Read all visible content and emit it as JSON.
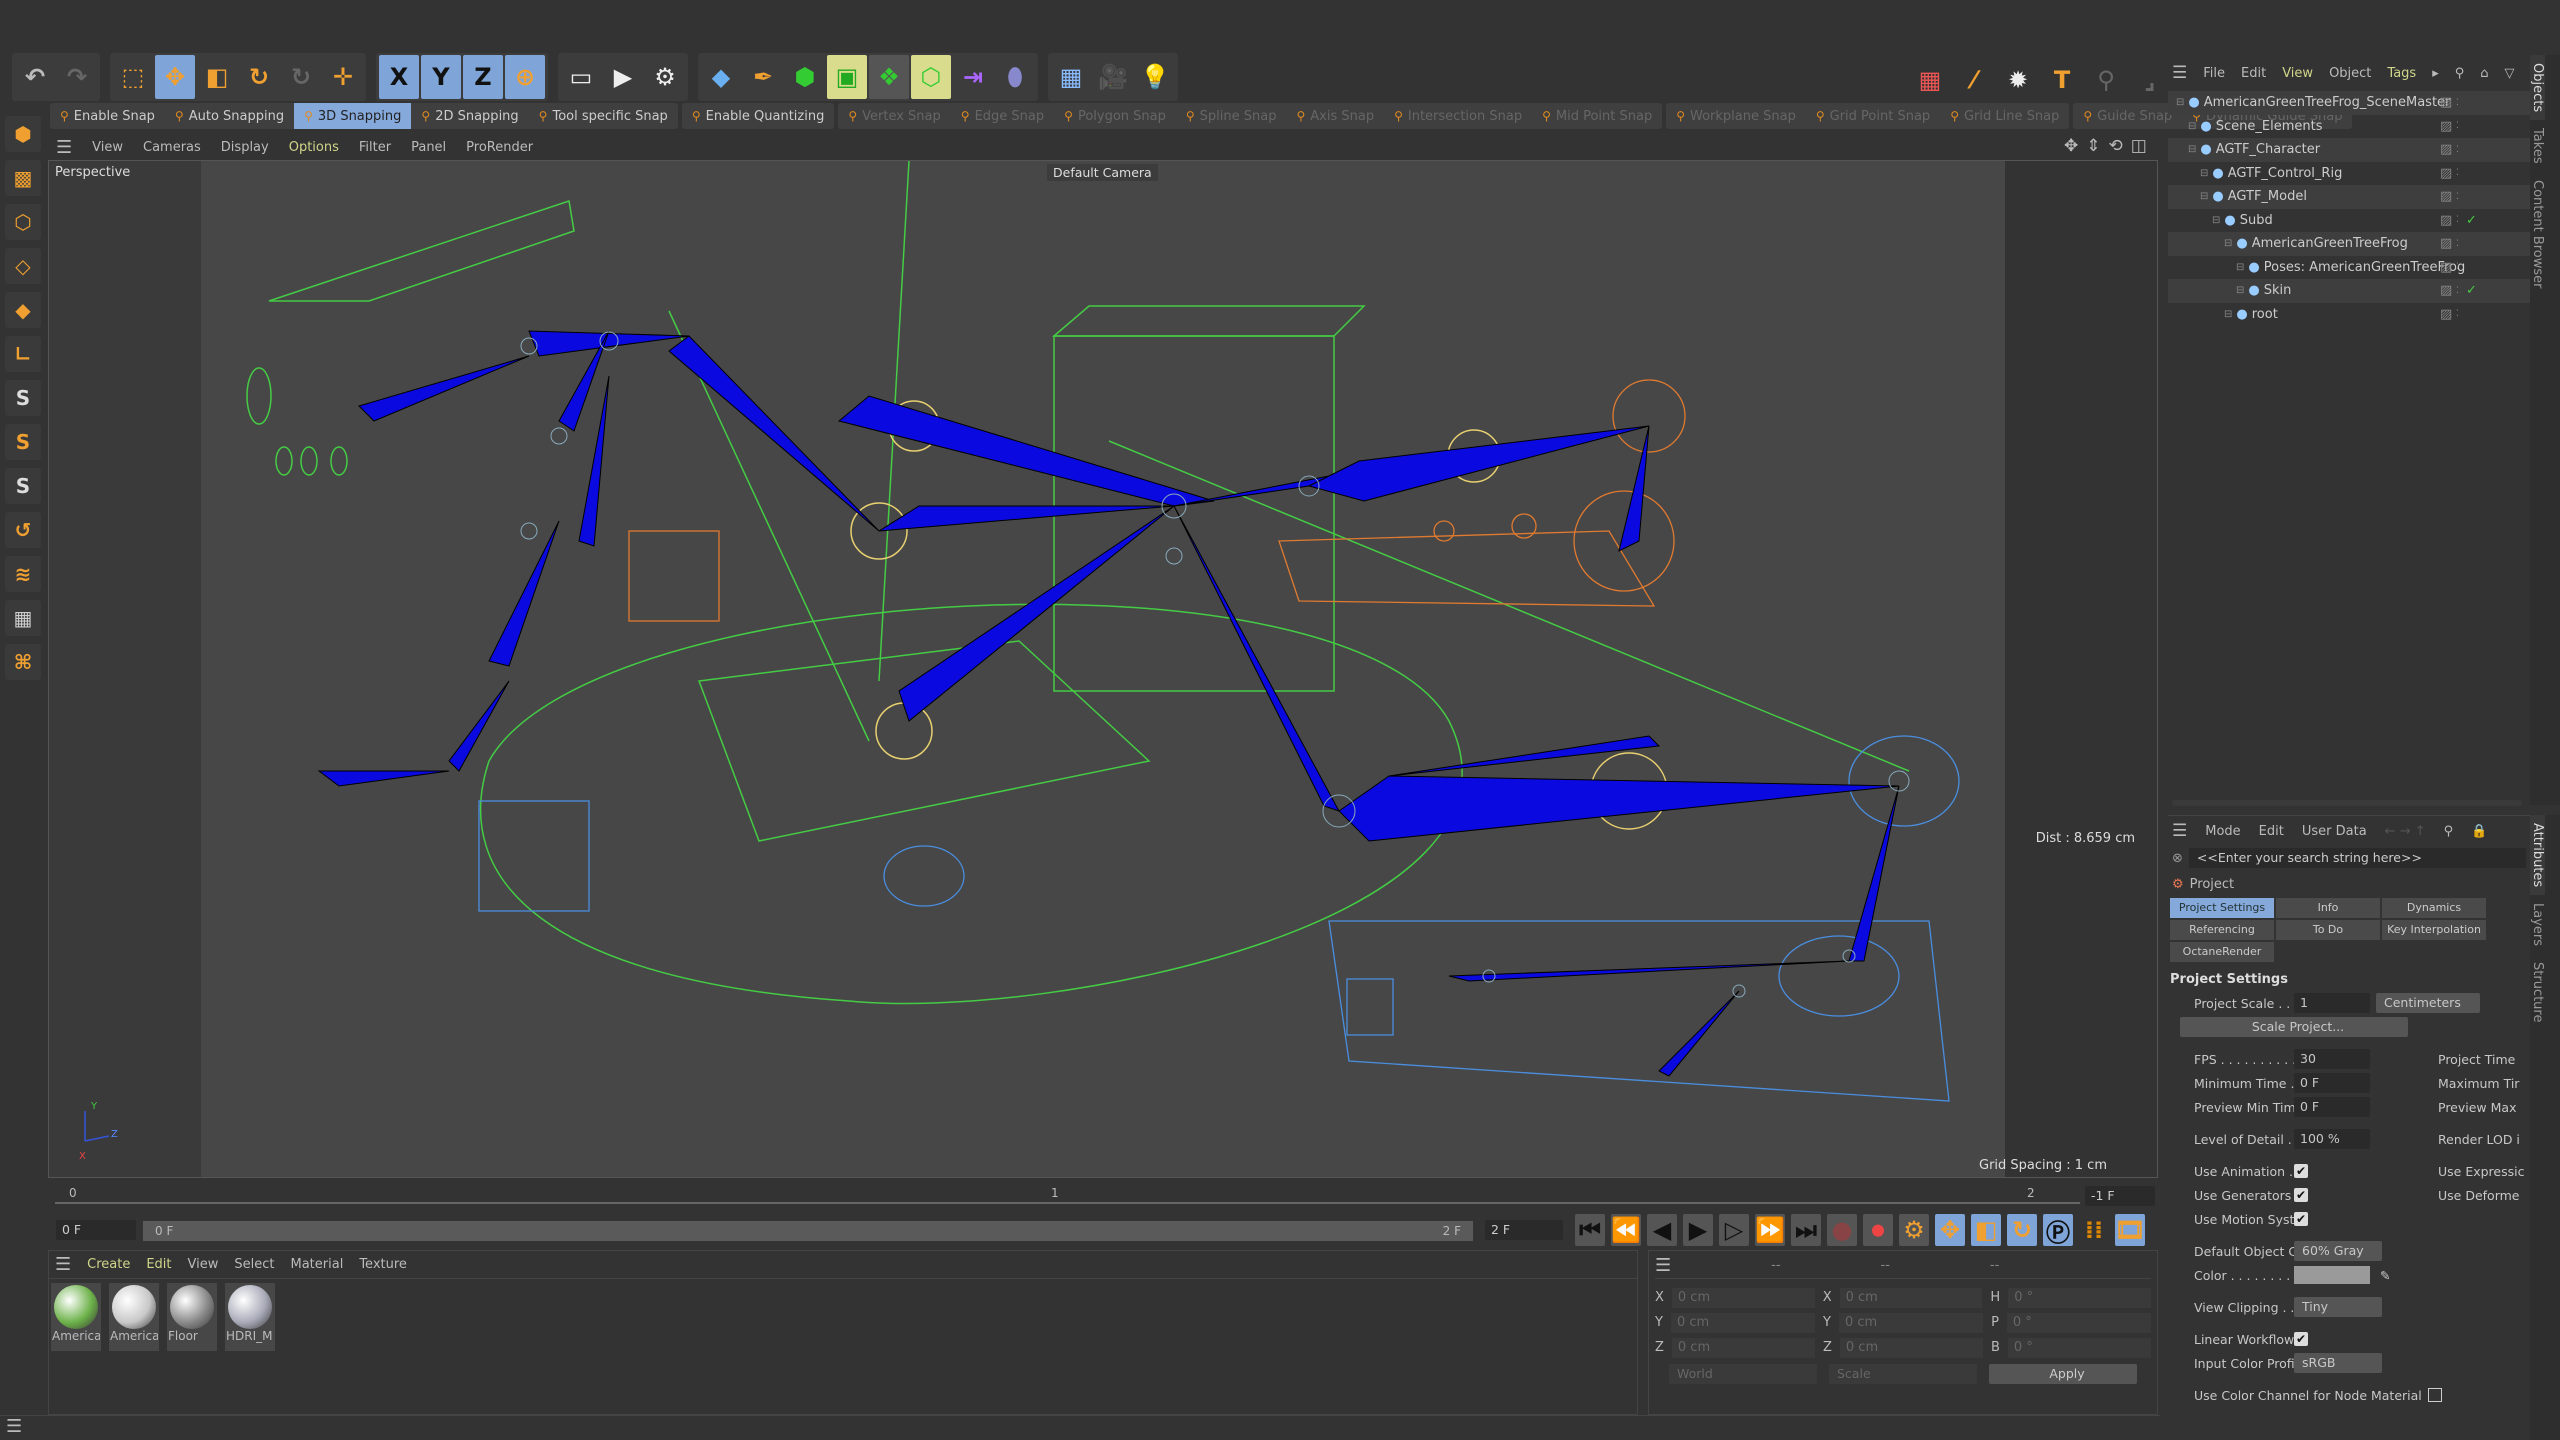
{
  "toolbar": {
    "items": [
      "undo-icon",
      "redo-icon",
      "select-icon",
      "move-icon",
      "scale-icon",
      "rotate-icon",
      "recent-tool-icon",
      "add-icon",
      "x-axis-lock",
      "y-axis-lock",
      "z-axis-lock",
      "coordinate-system",
      "render-view",
      "render",
      "render-settings",
      "cube",
      "pen",
      "subdivision",
      "generator",
      "deformer",
      "mograph",
      "field",
      "spline",
      "floor",
      "camera",
      "light"
    ],
    "axes": [
      "X",
      "Y",
      "Z"
    ]
  },
  "snap": {
    "items": [
      {
        "label": "Enable Snap",
        "active": false,
        "enabled": true
      },
      {
        "label": "Auto Snapping",
        "active": false,
        "enabled": true
      },
      {
        "label": "3D Snapping",
        "active": true,
        "enabled": true
      },
      {
        "label": "2D Snapping",
        "active": false,
        "enabled": true
      },
      {
        "label": "Tool specific Snap",
        "active": false,
        "enabled": true
      },
      {
        "label": "Enable Quantizing",
        "active": false,
        "enabled": true
      },
      {
        "label": "Vertex Snap",
        "enabled": false
      },
      {
        "label": "Edge Snap",
        "enabled": false
      },
      {
        "label": "Polygon Snap",
        "enabled": false
      },
      {
        "label": "Spline Snap",
        "enabled": false
      },
      {
        "label": "Axis Snap",
        "enabled": false
      },
      {
        "label": "Intersection Snap",
        "enabled": false
      },
      {
        "label": "Mid Point Snap",
        "enabled": false
      },
      {
        "label": "Workplane Snap",
        "enabled": false
      },
      {
        "label": "Grid Point Snap",
        "enabled": false
      },
      {
        "label": "Grid Line Snap",
        "enabled": false
      },
      {
        "label": "Guide Snap",
        "enabled": false
      },
      {
        "label": "Dynamic Guide Snap",
        "enabled": false
      }
    ]
  },
  "viewport": {
    "menu": [
      "View",
      "Cameras",
      "Display",
      "Options",
      "Filter",
      "Panel",
      "ProRender"
    ],
    "active_menu": "Options",
    "name": "Perspective",
    "camera": "Default Camera",
    "dist": "Dist : 8.659 cm",
    "grid": "Grid Spacing : 1 cm",
    "axis_labels": [
      "Y",
      "Z",
      "X"
    ]
  },
  "timeline": {
    "ticks": [
      "0",
      "1",
      "2"
    ],
    "current": "0 F",
    "slider_start": "0 F",
    "slider_end": "2 F",
    "end": "2 F",
    "max": "-1 F"
  },
  "materials": {
    "menu": [
      "Create",
      "Edit",
      "View",
      "Select",
      "Material",
      "Texture"
    ],
    "items": [
      {
        "name": "Americar",
        "color": "#6db24a"
      },
      {
        "name": "Americar",
        "color": "#c8c8c8"
      },
      {
        "name": "Floor",
        "color": "#8a8a8a"
      },
      {
        "name": "HDRI_M",
        "color": "#a8aab8"
      }
    ]
  },
  "coords": {
    "rows": [
      {
        "a": "X",
        "v1": "0 cm",
        "b": "X",
        "v2": "0 cm",
        "c": "H",
        "v3": "0 °"
      },
      {
        "a": "Y",
        "v1": "0 cm",
        "b": "Y",
        "v2": "0 cm",
        "c": "P",
        "v3": "0 °"
      },
      {
        "a": "Z",
        "v1": "0 cm",
        "b": "Z",
        "v2": "0 cm",
        "c": "B",
        "v3": "0 °"
      }
    ],
    "space": "World",
    "mode": "Scale",
    "apply": "Apply",
    "headers": [
      "--",
      "--",
      "--"
    ]
  },
  "objects": {
    "menu": [
      "File",
      "Edit",
      "View",
      "Object",
      "Tags"
    ],
    "tree": [
      {
        "name": "AmericanGreenTreeFrog_SceneMaster",
        "depth": 0
      },
      {
        "name": "Scene_Elements",
        "depth": 1
      },
      {
        "name": "AGTF_Character",
        "depth": 1
      },
      {
        "name": "AGTF_Control_Rig",
        "depth": 2
      },
      {
        "name": "AGTF_Model",
        "depth": 2
      },
      {
        "name": "Subd",
        "depth": 3
      },
      {
        "name": "AmericanGreenTreeFrog",
        "depth": 4
      },
      {
        "name": "Poses: AmericanGreenTreeFrog",
        "depth": 5
      },
      {
        "name": "Skin",
        "depth": 5
      },
      {
        "name": "root",
        "depth": 4
      }
    ]
  },
  "side_tabs_top": [
    "Objects",
    "Takes",
    "Content Browser"
  ],
  "side_tabs_bottom": [
    "Attributes",
    "Layers",
    "Structure"
  ],
  "attributes": {
    "menu": [
      "Mode",
      "Edit",
      "User Data"
    ],
    "search_placeholder": "<<Enter your search string here>>",
    "object": "Project",
    "tabs": [
      "Project Settings",
      "Info",
      "Dynamics",
      "Referencing",
      "To Do",
      "Key Interpolation",
      "OctaneRender"
    ],
    "section": "Project Settings",
    "project_scale_label": "Project Scale . . . .",
    "project_scale": "1",
    "unit": "Centimeters",
    "scale_project": "Scale Project...",
    "fps_label": "FPS . . . . . . . . . . .",
    "fps": "30",
    "project_time": "Project Time",
    "min_time_label": "Minimum Time . . .",
    "min_time": "0 F",
    "max_time": "Maximum Tir",
    "prev_min_label": "Preview Min Time. .",
    "prev_min": "0 F",
    "prev_max": "Preview Max",
    "lod_label": "Level of Detail . . .",
    "lod": "100 %",
    "render_lod": "Render LOD i",
    "use_animation": "Use Animation . . .",
    "use_generators": "Use Generators . . .",
    "use_motion": "Use Motion System",
    "use_expressions": "Use Expressic",
    "use_deformers": "Use Deforme",
    "default_color_label": "Default Object Color",
    "default_color": "60% Gray",
    "color_label": "Color . . . . . . . . .",
    "color_value": "#9a9a9a",
    "view_clipping_label": "View Clipping . . .",
    "view_clipping": "Tiny",
    "linear_label": "Linear Workflow. . .",
    "input_profile_label": "Input Color Profile .",
    "input_profile": "sRGB",
    "node_label": "Use Color Channel for Node Material",
    "check": "✔"
  },
  "colors": {
    "accent": "#86a9db",
    "bones": "#0a0ae0",
    "icon": "#f0a030"
  }
}
